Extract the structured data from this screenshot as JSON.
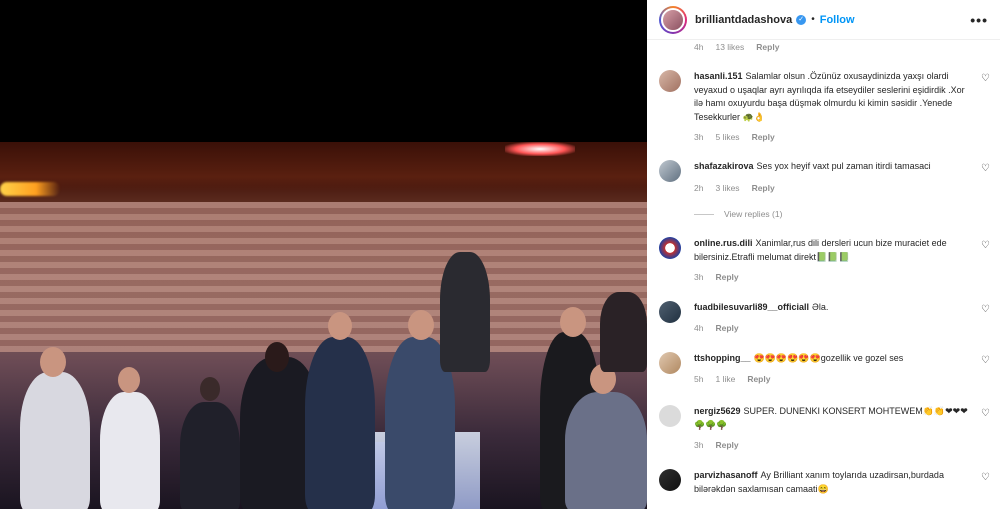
{
  "post": {
    "username": "brilliantdadashova",
    "follow_label": "Follow",
    "separator": "•",
    "more_label": "•••"
  },
  "top_meta": {
    "time": "4h",
    "likes": "13 likes",
    "reply": "Reply"
  },
  "comments": [
    {
      "user": "hasanli.151",
      "text": "Salamlar olsun .Özünüz oxusaydinizda yaxşı olardi veyaxud o uşaqlar ayrı ayrılıqda ifa etseydiler seslerini eşidirdik .Xor ilə hamı oxuyurdu başa düşmək olmurdu ki kimin səsidir .Yenede Tesekkurler 🐢👌",
      "time": "3h",
      "likes": "5 likes",
      "reply": "Reply"
    },
    {
      "user": "shafazakirova",
      "text": "Ses yox heyif vaxt pul zaman itirdi tamasaci",
      "time": "2h",
      "likes": "3 likes",
      "reply": "Reply",
      "view_replies": "View replies (1)"
    },
    {
      "user": "online.rus.dili",
      "text": "Xanimlar,rus dili dersleri ucun bize muraciet ede bilersiniz.Etrafli melumat direkt📗📗📗",
      "time": "3h",
      "reply": "Reply"
    },
    {
      "user": "fuadbilesuvarli89__officiall",
      "text": "Əla.",
      "time": "4h",
      "reply": "Reply"
    },
    {
      "user": "ttshopping__",
      "text": "😍😍😍😍😍😍gozellik ve gozel ses",
      "time": "5h",
      "likes": "1 like",
      "reply": "Reply"
    },
    {
      "user": "nergiz5629",
      "text": "SUPER. DUNENKI KONSERT MOHTEWEM👏👏❤❤❤🌳🌳🌳",
      "time": "3h",
      "reply": "Reply"
    },
    {
      "user": "parvizhasanoff",
      "text": "Ay Brilliant xanım toylarıda uzadirsan,burdada bilərəkdən saxlamısan camaati😄"
    }
  ],
  "icons": {
    "heart": "heart-icon",
    "verified": "verified-badge-icon",
    "more": "more-options-icon"
  },
  "colors": {
    "accent": "#0095f6",
    "muted": "#8e8e8e",
    "text": "#262626"
  }
}
